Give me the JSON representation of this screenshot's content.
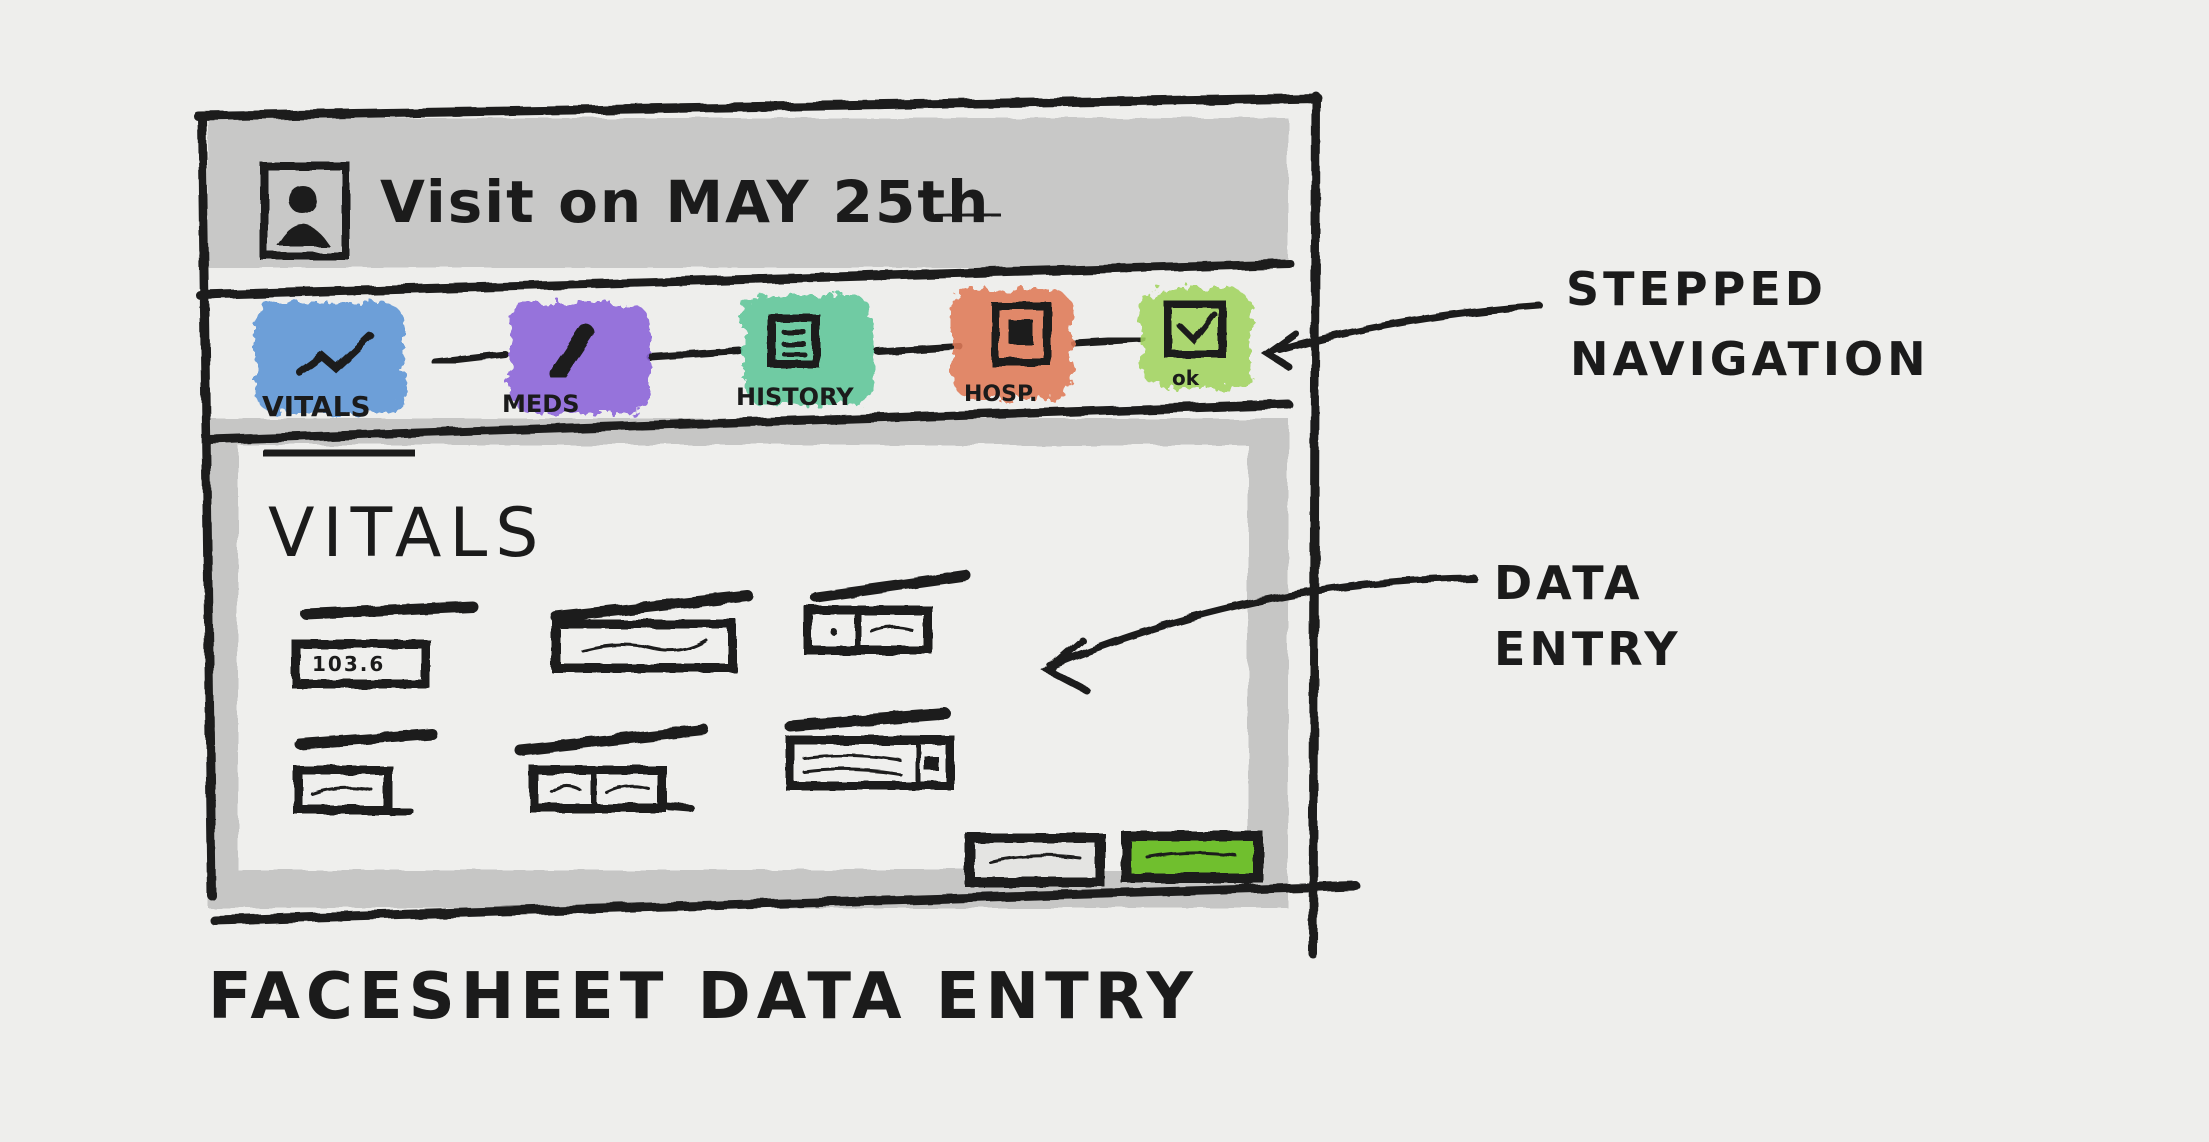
{
  "window": {
    "title": "Visit on MAY 25th",
    "avatar_icon": "patient-avatar-icon"
  },
  "stepper": {
    "steps": [
      {
        "label": "VITALS",
        "icon": "vitals-chart-icon",
        "color": "#5b95d6",
        "active": true
      },
      {
        "label": "MEDS",
        "icon": "pill-icon",
        "color": "#8a63d9",
        "active": false
      },
      {
        "label": "HISTORY",
        "icon": "history-doc-icon",
        "color": "#5ec79a",
        "active": false
      },
      {
        "label": "HOSP.",
        "icon": "hospital-icon",
        "color": "#e07a58",
        "active": false
      },
      {
        "label": "ok",
        "icon": "checkbox-icon",
        "color": "#a2d45e",
        "active": false
      }
    ]
  },
  "main": {
    "section_title": "VITALS",
    "first_field_value": "103.6",
    "primary_button_color": "#6fbf2e"
  },
  "annotations": {
    "stepped_navigation": [
      "STEPPED",
      "NAVIGATION"
    ],
    "data_entry": [
      "DATA",
      "ENTRY"
    ]
  },
  "caption": "FACESHEET DATA ENTRY"
}
